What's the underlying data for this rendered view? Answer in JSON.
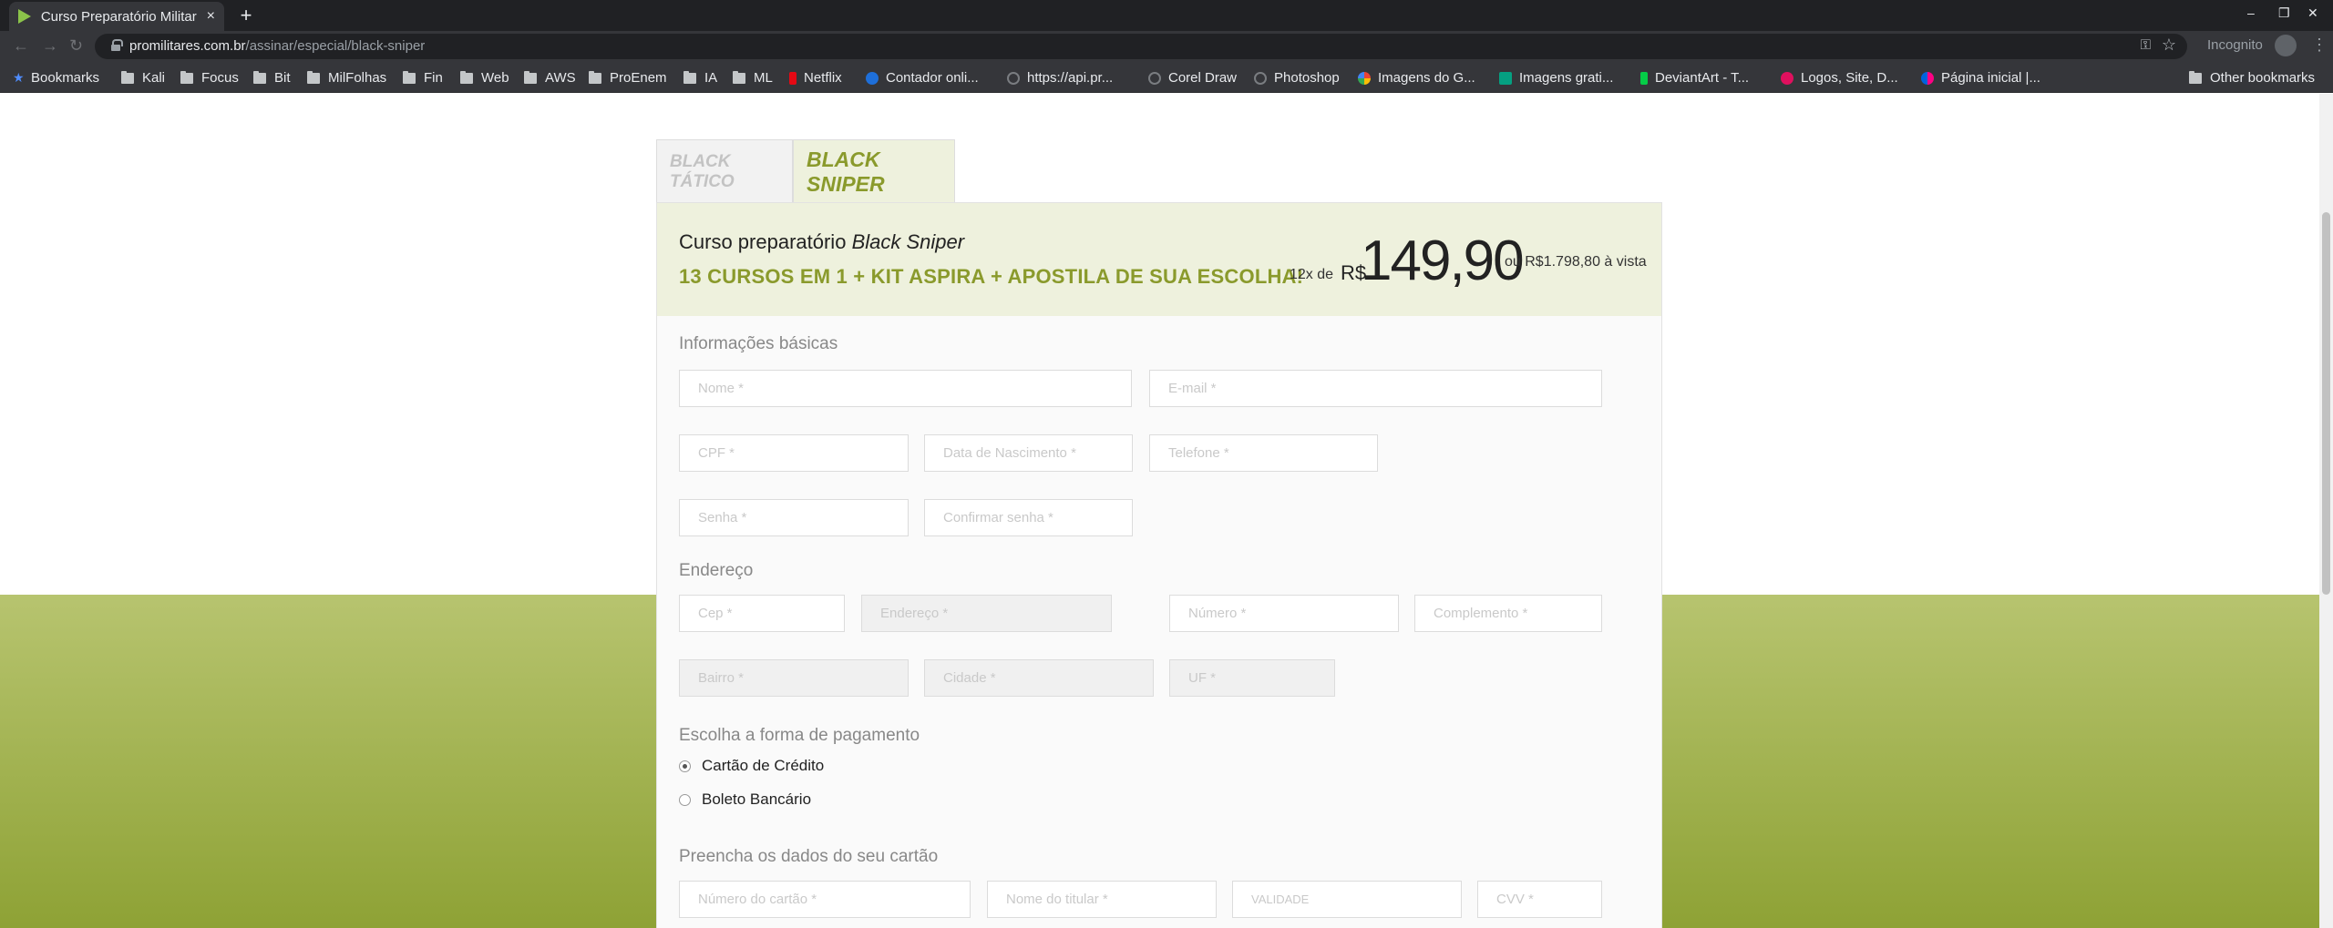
{
  "browser": {
    "tab_title": "Curso Preparatório Militar",
    "tab_close": "×",
    "new_tab": "+",
    "url_host": "promilitares.com.br",
    "url_path": "/assinar/especial/black-sniper",
    "incognito_label": "Incognito",
    "window_controls": [
      "–",
      "❐",
      "✕"
    ],
    "nav": {
      "back": "←",
      "forward": "→",
      "reload": "↻"
    },
    "bookmarks": [
      {
        "label": "Bookmarks",
        "icon": "star-icon"
      },
      {
        "label": "Kali",
        "icon": "folder-icon"
      },
      {
        "label": "Focus",
        "icon": "folder-icon"
      },
      {
        "label": "Bit",
        "icon": "folder-icon"
      },
      {
        "label": "MilFolhas",
        "icon": "folder-icon"
      },
      {
        "label": "Fin",
        "icon": "folder-icon"
      },
      {
        "label": "Web",
        "icon": "folder-icon"
      },
      {
        "label": "AWS",
        "icon": "folder-icon"
      },
      {
        "label": "ProEnem",
        "icon": "folder-icon"
      },
      {
        "label": "IA",
        "icon": "folder-icon"
      },
      {
        "label": "ML",
        "icon": "folder-icon"
      },
      {
        "label": "Netflix",
        "icon": "netflix-icon"
      },
      {
        "label": "Contador onli...",
        "icon": "contador-icon"
      },
      {
        "label": "https://api.pr...",
        "icon": "globe-icon"
      },
      {
        "label": "Corel Draw",
        "icon": "globe-icon"
      },
      {
        "label": "Photoshop",
        "icon": "globe-icon"
      },
      {
        "label": "Imagens do G...",
        "icon": "google-icon"
      },
      {
        "label": "Imagens grati...",
        "icon": "pexels-icon"
      },
      {
        "label": "DeviantArt - T...",
        "icon": "deviantart-icon"
      },
      {
        "label": "Logos, Site, D...",
        "icon": "logos-icon"
      },
      {
        "label": "Página inicial |...",
        "icon": "flickr-icon"
      },
      {
        "label": "Other bookmarks",
        "icon": "folder-icon"
      }
    ],
    "colors": {
      "chrome_dark": "#202124",
      "chrome_mid": "#35363a"
    }
  },
  "plans": {
    "tabs": [
      {
        "label": "BLACK TÁTICO",
        "active": false
      },
      {
        "label": "BLACK SNIPER",
        "active": true
      }
    ]
  },
  "header": {
    "course_prefix": "Curso preparatório",
    "course_name": "Black Sniper",
    "subtitle": "13 CURSOS EM 1 + KIT ASPIRA + APOSTILA DE SUA ESCOLHA!",
    "installments": "12x de",
    "currency": "R$",
    "price": "149,90",
    "cash_price": "ou R$1.798,80 à vista"
  },
  "form": {
    "basic_title": "Informações básicas",
    "address_title": "Endereço",
    "payment_title": "Escolha a forma de pagamento",
    "card_title": "Preencha os dados do seu cartão",
    "placeholders": {
      "nome": "Nome *",
      "email": "E-mail *",
      "cpf": "CPF *",
      "nascimento": "Data de Nascimento *",
      "telefone": "Telefone *",
      "senha": "Senha *",
      "confirmar": "Confirmar senha *",
      "cep": "Cep *",
      "endereco": "Endereço *",
      "numero": "Número *",
      "complemento": "Complemento *",
      "bairro": "Bairro *",
      "cidade": "Cidade *",
      "uf": "UF *",
      "numero_cartao": "Número do cartão *",
      "nome_titular": "Nome do titular *",
      "validade": "VALIDADE",
      "cvv": "CVV *"
    },
    "payment_options": [
      {
        "label": "Cartão de Crédito",
        "checked": true
      },
      {
        "label": "Boleto Bancário",
        "checked": false
      }
    ]
  },
  "colors": {
    "accent_green": "#8a9a2c",
    "header_bg": "#eef1dd"
  }
}
